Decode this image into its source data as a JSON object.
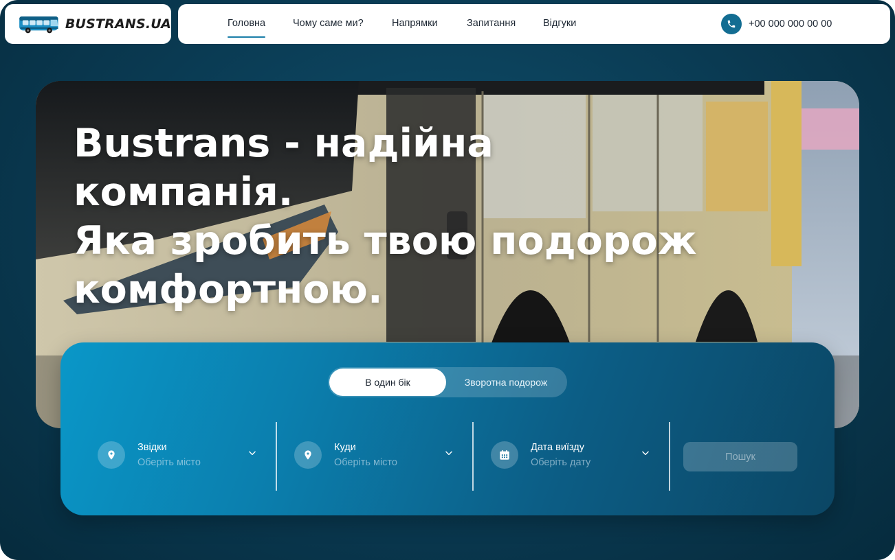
{
  "header": {
    "logo_text": "BUSTRANS.UA",
    "nav": [
      {
        "label": "Головна",
        "active": true
      },
      {
        "label": "Чому саме ми?",
        "active": false
      },
      {
        "label": "Напрямки",
        "active": false
      },
      {
        "label": "Запитання",
        "active": false
      },
      {
        "label": "Відгуки",
        "active": false
      }
    ],
    "phone": "+00 000 000 00 00",
    "phone_icon": "phone-icon"
  },
  "hero": {
    "title_lines": [
      "Bustrans - надійна компанія.",
      "Яка зробить твою подорож",
      "комфортною."
    ]
  },
  "search": {
    "trip_type": {
      "selected": "В один бік",
      "other": "Зворотна подорож"
    },
    "fields": [
      {
        "label": "Звідки",
        "placeholder": "Оберіть місто",
        "icon": "location-pin-icon"
      },
      {
        "label": "Куди",
        "placeholder": "Оберіть місто",
        "icon": "location-pin-icon"
      },
      {
        "label": "Дата виїзду",
        "placeholder": "Оберіть дату",
        "icon": "calendar-icon"
      }
    ],
    "button_label": "Пошук"
  },
  "colors": {
    "accent": "#136d92",
    "background": "#0a3a52",
    "panel_start": "#0a97c8",
    "panel_end": "#0b4664"
  }
}
